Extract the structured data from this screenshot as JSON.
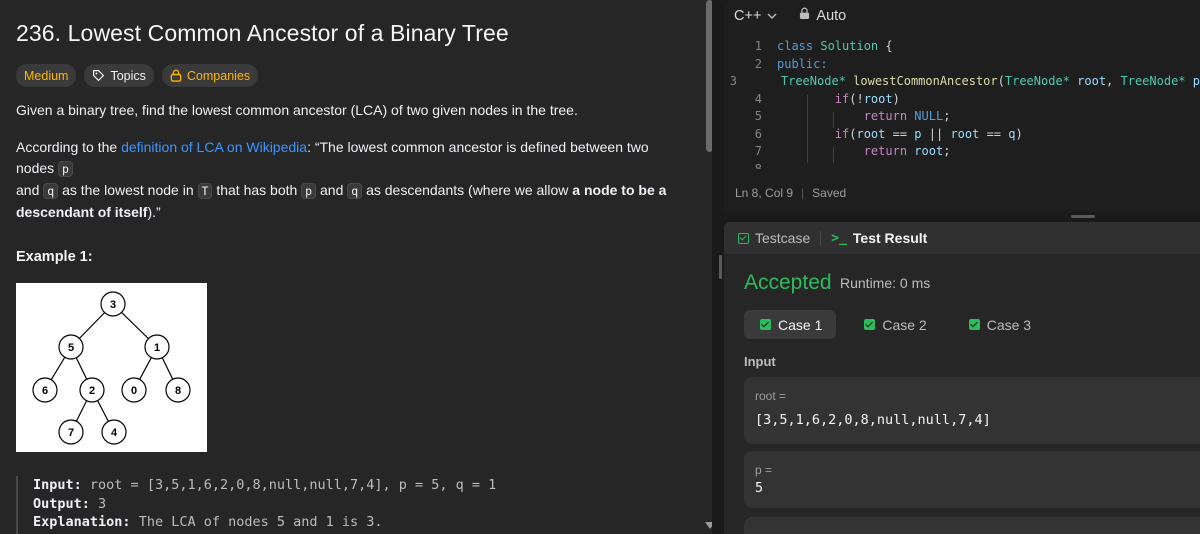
{
  "problem": {
    "title": "236. Lowest Common Ancestor of a Binary Tree",
    "difficulty": "Medium",
    "topics_label": "Topics",
    "companies_label": "Companies",
    "desc1": "Given a binary tree, find the lowest common ancestor (LCA) of two given nodes in the tree.",
    "desc2_a": "According to the ",
    "desc2_link": "definition of LCA on Wikipedia",
    "desc2_b": ": “The lowest common ancestor is defined between two nodes ",
    "code_p": "p",
    "desc2_c": "and ",
    "code_q": "q",
    "desc2_d": " as the lowest node in ",
    "code_T": "T",
    "desc2_e": " that has both ",
    "desc2_f": " and ",
    "desc2_g": " as descendants (where we allow ",
    "desc2_bold": "a node to be a descendant of itself",
    "desc2_h": ").”",
    "example_title": "Example 1:",
    "tree_nodes": [
      "3",
      "5",
      "1",
      "6",
      "2",
      "0",
      "8",
      "7",
      "4"
    ],
    "example": {
      "input_label": "Input:",
      "input_value": "root = [3,5,1,6,2,0,8,null,null,7,4], p = 5, q = 1",
      "output_label": "Output:",
      "output_value": "3",
      "explanation_label": "Explanation:",
      "explanation_value": "The LCA of nodes 5 and 1 is 3."
    }
  },
  "editor": {
    "language": "C++",
    "mode": "Auto",
    "line_numbers": [
      "1",
      "2",
      "3",
      "4",
      "5",
      "6",
      "7",
      "8"
    ],
    "status_position": "Ln 8, Col 9",
    "status_saved": "Saved",
    "code": {
      "l1_kw": "class",
      "l1_name": "Solution",
      "l1_brace": " {",
      "l2": "public:",
      "l3_type": "TreeNode*",
      "l3_fn": "lowestCommonAncestor",
      "l3_open": "(",
      "l3_t1": "TreeNode*",
      "l3_v1": "root",
      "l3_comma": ", ",
      "l3_t2": "TreeNode*",
      "l3_v2": "p",
      "l4_kw": "if",
      "l4_rest": "(!",
      "l4_var": "root",
      "l4_close": ")",
      "l5_kw": "return",
      "l5_val": "NULL",
      "l5_end": ";",
      "l6_kw": "if",
      "l6_open": "(",
      "l6_v1": "root",
      "l6_op1": " == ",
      "l6_v2": "p",
      "l6_or": " || ",
      "l6_v3": "root",
      "l6_op2": " == ",
      "l6_v4": "q",
      "l6_close": ")",
      "l7_kw": "return",
      "l7_var": "root",
      "l7_end": ";"
    }
  },
  "result": {
    "tab_testcase": "Testcase",
    "tab_result": "Test Result",
    "status": "Accepted",
    "runtime": "Runtime: 0 ms",
    "cases": [
      "Case 1",
      "Case 2",
      "Case 3"
    ],
    "input_label": "Input",
    "root_label": "root =",
    "root_value": "[3,5,1,6,2,0,8,null,null,7,4]",
    "p_label": "p =",
    "p_value": "5"
  },
  "colors": {
    "accepted": "#2cbb5d",
    "medium": "#ffb800",
    "link": "#3e96ff"
  }
}
